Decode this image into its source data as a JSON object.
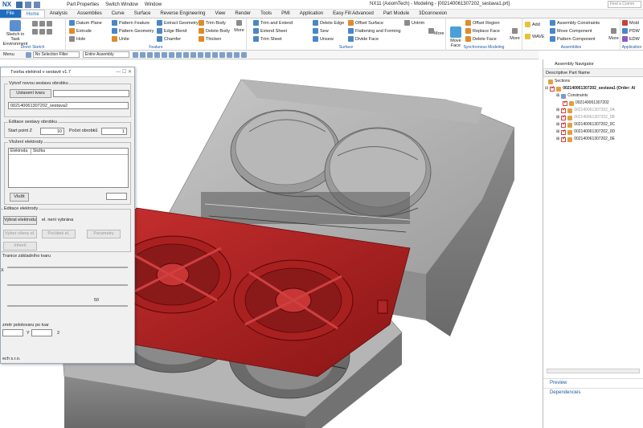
{
  "titlebar": {
    "logo": "NX",
    "part_properties": "Part Properties",
    "switch_window": "Switch Window",
    "window_menu": "Window",
    "title": "NX11 (AxiomTech) - Modeling - [002140061307202_sestava1.prt]",
    "find_placeholder": "Find a Comm"
  },
  "tabs": [
    "File",
    "Home",
    "Analysis",
    "Assemblies",
    "Curve",
    "Surface",
    "Reverse Engineering",
    "View",
    "Render",
    "Tools",
    "PMI",
    "Application",
    "Easy Fill Advanced",
    "Part Module",
    "3Dconnexion"
  ],
  "ribbon": {
    "direct_sketch": {
      "sketch_btn": "Sketch in Task Environment",
      "label": "Direct Sketch"
    },
    "feature": {
      "datum_plane": "Datum Plane",
      "extrude": "Extrude",
      "hole": "Hole",
      "pattern_feature": "Pattern Feature",
      "pattern_geometry": "Pattern Geometry",
      "unite": "Unite",
      "extract_geometry": "Extract Geometry",
      "edge_blend": "Edge Blend",
      "chamfer": "Chamfer",
      "trim_body": "Trim Body",
      "delete_body": "Delete Body",
      "thicken": "Thicken",
      "more": "More",
      "label": "Feature"
    },
    "surface": {
      "trim_and_extend": "Trim and Extend",
      "extend_sheet": "Extend Sheet",
      "trim_sheet": "Trim Sheet",
      "delete_edge": "Delete Edge",
      "sew": "Sew",
      "unsew": "Unsew",
      "offset_surface": "Offset Surface",
      "flattening": "Flattening and Forming",
      "divide_face": "Divide Face",
      "untrim": "Untrim",
      "more": "More",
      "label": "Surface"
    },
    "sync": {
      "move_face": "Move Face",
      "offset_region": "Offset Region",
      "replace_face": "Replace Face",
      "delete_face": "Delete Face",
      "more": "More",
      "label": "Synchronous Modeling"
    },
    "assemblies": {
      "add": "Add",
      "wave": "WAVE",
      "assembly_constraints": "Assembly Constraints",
      "move_component": "Move Component",
      "pattern_component": "Pattern Component",
      "more": "More",
      "label": "Assemblies"
    },
    "application": {
      "mold": "Mold",
      "pdw": "PDW",
      "edw": "EDW",
      "label": "Application"
    }
  },
  "toolbar2": {
    "menu": "Menu",
    "filter": "No Selection Filter",
    "scope": "Entire Assembly"
  },
  "dialog": {
    "title": "Tvorba elektrod v sestavě v1.7",
    "fs1_label": "Vytvoř novou sestavu obrobku",
    "setup_shape_btn": "Ustavení tvaru",
    "assembly_name": "002140061307202_sestava2",
    "fs2_label": "Editace sestavy obrobku",
    "start_point_label": "Start point Z",
    "start_point_value": "10",
    "count_label": "Počet obrobků",
    "count_value": "1",
    "fs3_label": "Vložení elektrody",
    "col_electrode": "Elektroda",
    "col_folder": "Složka",
    "insert_btn": "Vložit",
    "fs4_label": "Editace elektrody",
    "select_btn": "Vybrat elektrodu",
    "not_selected": "el. není vybrána",
    "select_all_btn": "Vyber všeny el.",
    "count_el_btn": "Počátek el.",
    "params_btn": "Parametry",
    "inherit_btn": "Inherit",
    "slider_label": "Tranice základního tvaru",
    "slider_x": "X",
    "slider_max": "50",
    "size_label": "změr polotovaru po tvar",
    "y_label": "Y",
    "z_value": "2",
    "footer": "ech s.r.o."
  },
  "nav": {
    "title": "Assembly Navigator",
    "column": "Descriptive Part Name",
    "sections": "Sections",
    "root": "002140061307202_sestava1 (Order: Al",
    "constraints": "Constraints",
    "parts": [
      "002140061307202",
      "002140061307202_0A",
      "002140061307202_0B",
      "002140061307202_0C",
      "002140061307202_0D",
      "002140061307202_0E"
    ],
    "preview": "Preview",
    "dependencies": "Dependencies"
  },
  "colors": {
    "accent": "#1e6fbf",
    "electrode_red": "#b52020",
    "mold_gray": "#9a9a9a"
  }
}
